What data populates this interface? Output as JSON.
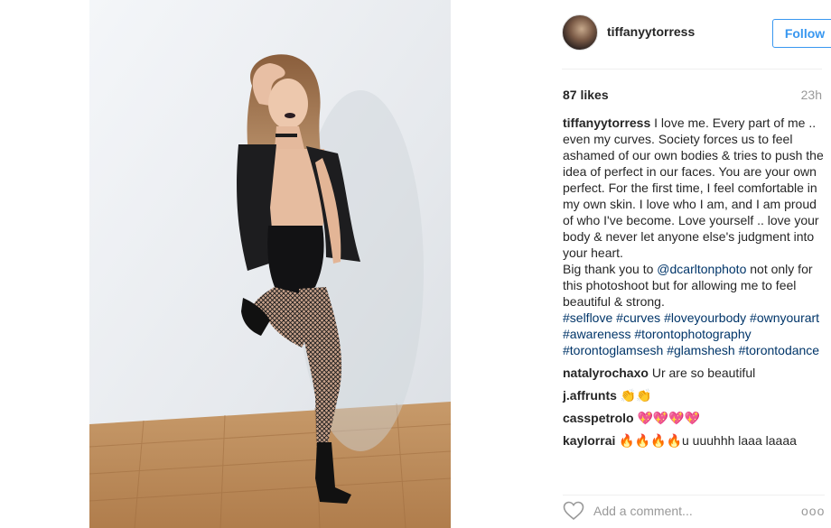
{
  "post": {
    "username": "tiffanyytorress",
    "follow_label": "Follow",
    "likes": "87 likes",
    "time": "23h",
    "caption": {
      "user": "tiffanyytorress",
      "text1": "I love me. Every part of me .. even my curves. Society forces us to feel ashamed of our own bodies & tries to push the idea of perfect in our faces. You are your own perfect. For the first time, I feel comfortable in my own skin. I love who I am, and I am proud of who I've become. Love yourself .. love your body & never let anyone else's judgment into your heart.",
      "text2": "Big thank you to",
      "mention": "@dcarltonphoto",
      "text3": "not only for this photoshoot but for allowing me to feel beautiful & strong.",
      "hashtags": [
        "#selflove",
        "#curves",
        "#loveyourbody",
        "#ownyourart",
        "#awareness",
        "#torontophotography",
        "#torontoglamsesh",
        "#glamshesh",
        "#torontodance"
      ]
    },
    "comments": [
      {
        "user": "natalyrochaxo",
        "text": "Ur are so beautiful"
      },
      {
        "user": "j.affrunts",
        "text": "👏👏"
      },
      {
        "user": "casspetrolo",
        "text": "💖💖💖💖"
      },
      {
        "user": "kaylorrai",
        "text": "🔥🔥🔥🔥u uuuhhh laaa laaaa"
      }
    ],
    "add_comment_placeholder": "Add a comment...",
    "more_label": "ooo"
  },
  "icons": {
    "heart": "heart-icon",
    "more": "more-options-icon"
  },
  "colors": {
    "accent": "#3897f0",
    "link": "#003569",
    "muted": "#999999"
  }
}
